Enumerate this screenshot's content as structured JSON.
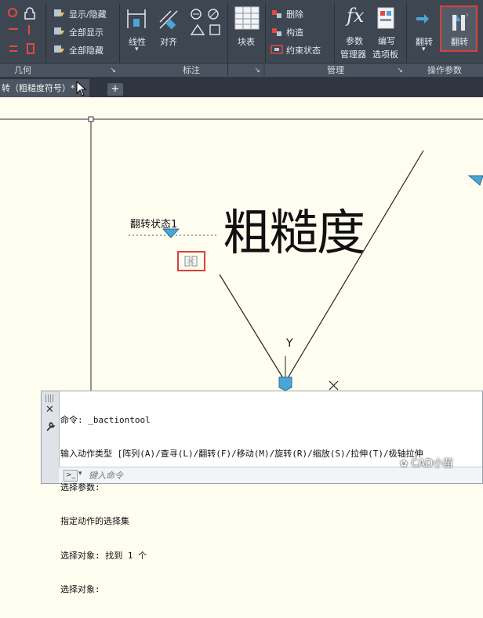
{
  "ribbon": {
    "geometry_panel": {
      "label": "几何"
    },
    "visibility": {
      "show_hide": "显示/隐藏",
      "show_all": "全部显示",
      "hide_all": "全部隐藏"
    },
    "dimension_panel": {
      "label": "标注",
      "linear": "线性",
      "align": "对齐"
    },
    "block_table": "块表",
    "manage_panel": {
      "label": "管理",
      "delete": "删除",
      "construct": "构造",
      "constraint_status": "约束状态",
      "param_manager": [
        "参数",
        "管理器"
      ],
      "write_palette": [
        "编写",
        "选项板"
      ]
    },
    "action_params_panel": {
      "label": "操作参数",
      "flip_param": "翻转",
      "flip_action": "翻转"
    }
  },
  "tabs": {
    "doc_tab": "转（粗糙度符号）*",
    "plus": "+"
  },
  "drawing": {
    "flip_state_label": "翻转状态1",
    "roughness_text": "粗糙度",
    "y_axis": "Y",
    "x_axis": "X"
  },
  "command": {
    "lines": [
      "命令: _bactiontool",
      "输入动作类型 [阵列(A)/查寻(L)/翻转(F)/移动(M)/旋转(R)/缩放(S)/拉伸(T)/极轴拉伸",
      "选择参数:",
      "指定动作的选择集",
      "选择对象: 找到 1 个",
      "选择对象:"
    ],
    "placeholder": "键入命令"
  },
  "watermark": "CAD小苗",
  "colors": {
    "ribbon_bg": "#3e4651",
    "highlight": "#d9413b",
    "canvas_bg": "#fffdf0",
    "grip_blue": "#4aa6d8"
  }
}
